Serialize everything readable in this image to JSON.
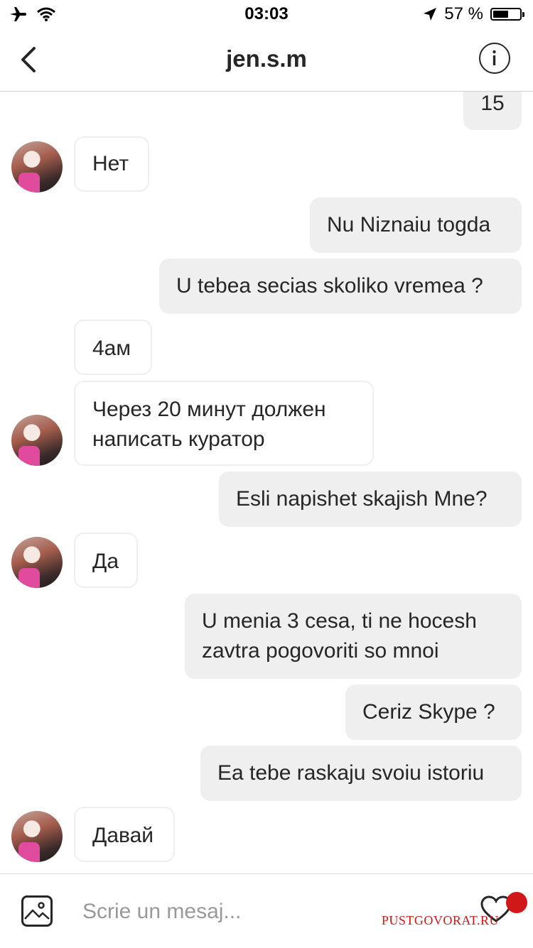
{
  "status_bar": {
    "time": "03:03",
    "battery": "57 %",
    "battery_level": 0.57
  },
  "header": {
    "title": "jen.s.m"
  },
  "messages": [
    {
      "side": "out",
      "text": "15"
    },
    {
      "side": "in",
      "text": "Нет"
    },
    {
      "side": "out",
      "text": "Nu Niznaiu togda"
    },
    {
      "side": "out",
      "text": "U tebea secias skoliko vremea ?"
    },
    {
      "side": "in",
      "text": "4ам"
    },
    {
      "side": "in",
      "text": "Через 20 минут должен\nнаписать куратор"
    },
    {
      "side": "out",
      "text": "Esli napishet skajish Mne?"
    },
    {
      "side": "in",
      "text": "Да"
    },
    {
      "side": "out",
      "text": "U menia 3 cesa, ti ne hocesh\nzavtra pogovoriti so mnoi"
    },
    {
      "side": "out",
      "text": "Ceriz Skype ?"
    },
    {
      "side": "out",
      "text": "Ea tebe raskaju svoiu istoriu"
    },
    {
      "side": "in",
      "text": "Давай"
    }
  ],
  "composer": {
    "placeholder": "Scrie un mesaj..."
  },
  "watermark": {
    "text": "PUSTGOVORAT.RU"
  },
  "colors": {
    "bubble_out": "#efefef",
    "bubble_in_border": "#efefef",
    "text": "#262626",
    "watermark": "#d01818"
  }
}
